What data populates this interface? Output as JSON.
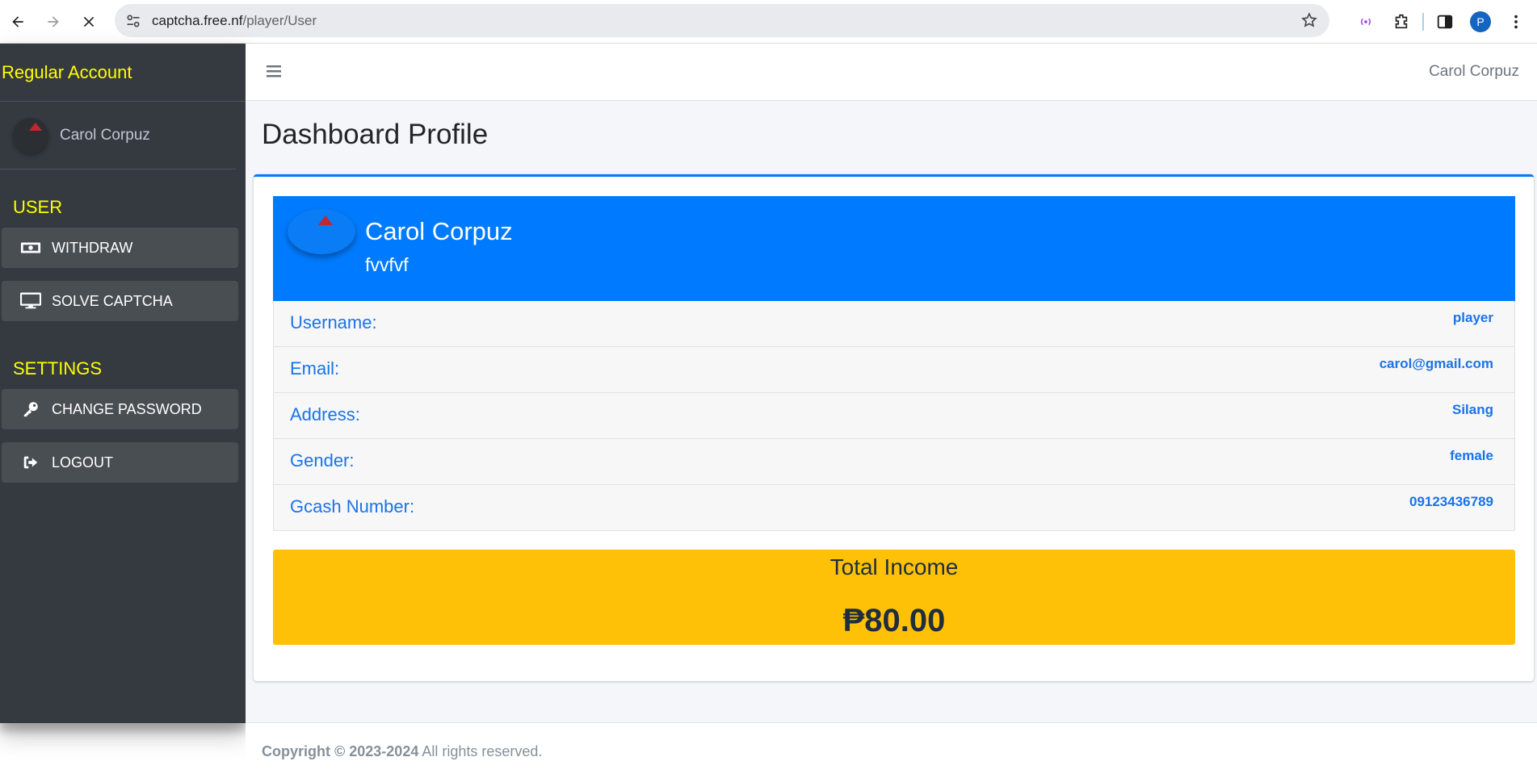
{
  "browser": {
    "url_host": "captcha.free.nf",
    "url_path": "/player/User",
    "profile_initial": "P"
  },
  "sidebar": {
    "brand": "Regular Account",
    "user_name": "Carol Corpuz",
    "sections": [
      {
        "header": "USER",
        "items": [
          {
            "label": "WITHDRAW",
            "icon": "money-bill-icon"
          },
          {
            "label": "SOLVE CAPTCHA",
            "icon": "desktop-icon"
          }
        ]
      },
      {
        "header": "SETTINGS",
        "items": [
          {
            "label": "CHANGE PASSWORD",
            "icon": "key-icon"
          },
          {
            "label": "LOGOUT",
            "icon": "sign-out-icon"
          }
        ]
      }
    ]
  },
  "header": {
    "user_name": "Carol Corpuz"
  },
  "main": {
    "page_title": "Dashboard Profile",
    "profile": {
      "name": "Carol Corpuz",
      "subtitle": "fvvfvf"
    },
    "info": [
      {
        "label": "Username:",
        "value": "player"
      },
      {
        "label": "Email:",
        "value": "carol@gmail.com"
      },
      {
        "label": "Address:",
        "value": "Silang"
      },
      {
        "label": "Gender:",
        "value": "female"
      },
      {
        "label": "Gcash Number:",
        "value": "09123436789"
      }
    ],
    "income": {
      "title": "Total Income",
      "amount": "₱80.00"
    }
  },
  "footer": {
    "copyright": "Copyright © 2023-2024",
    "rights": " All rights reserved."
  },
  "colors": {
    "accent": "#007bff",
    "sidebar_bg": "#343a40",
    "brand_yellow": "#ffff00",
    "income_bg": "#ffc107"
  }
}
